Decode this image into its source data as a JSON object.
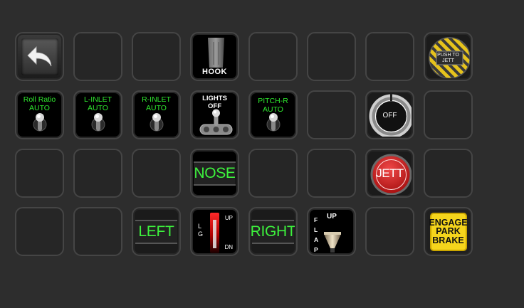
{
  "keys": {
    "back": {
      "icon": "back-arrow-icon"
    },
    "hook": {
      "label": "HOOK"
    },
    "push_to_jett": {
      "label": "PUSH TO\nJETT",
      "colors": {
        "stripe_a": "#e6c31c",
        "stripe_b": "#3a3a3a"
      }
    },
    "roll_ratio": {
      "label": "Roll Ratio\nAUTO"
    },
    "l_inlet": {
      "label": "L-INLET\nAUTO"
    },
    "r_inlet": {
      "label": "R-INLET\nAUTO"
    },
    "lights": {
      "label": "LIGHTS\nOFF"
    },
    "pitch_r": {
      "label": "PITCH-R\nAUTO"
    },
    "off_knob": {
      "label": "OFF"
    },
    "nose": {
      "label": "NOSE"
    },
    "jett": {
      "label": "JETT"
    },
    "left": {
      "label": "LEFT"
    },
    "landing_gear": {
      "letter_l": "L",
      "letter_g": "G",
      "up": "UP",
      "dn": "DN"
    },
    "right": {
      "label": "RIGHT"
    },
    "flap": {
      "up": "UP",
      "letters": [
        "F",
        "L",
        "A",
        "P"
      ]
    },
    "park_brake": {
      "label": "ENGAGE\nPARK\nBRAKE"
    }
  },
  "colors": {
    "background": "#2d2d2d",
    "key_border": "#454545",
    "indicator_green": "#2ee62e",
    "jett_red": "#d42020",
    "park_yellow": "#f5d51c"
  }
}
